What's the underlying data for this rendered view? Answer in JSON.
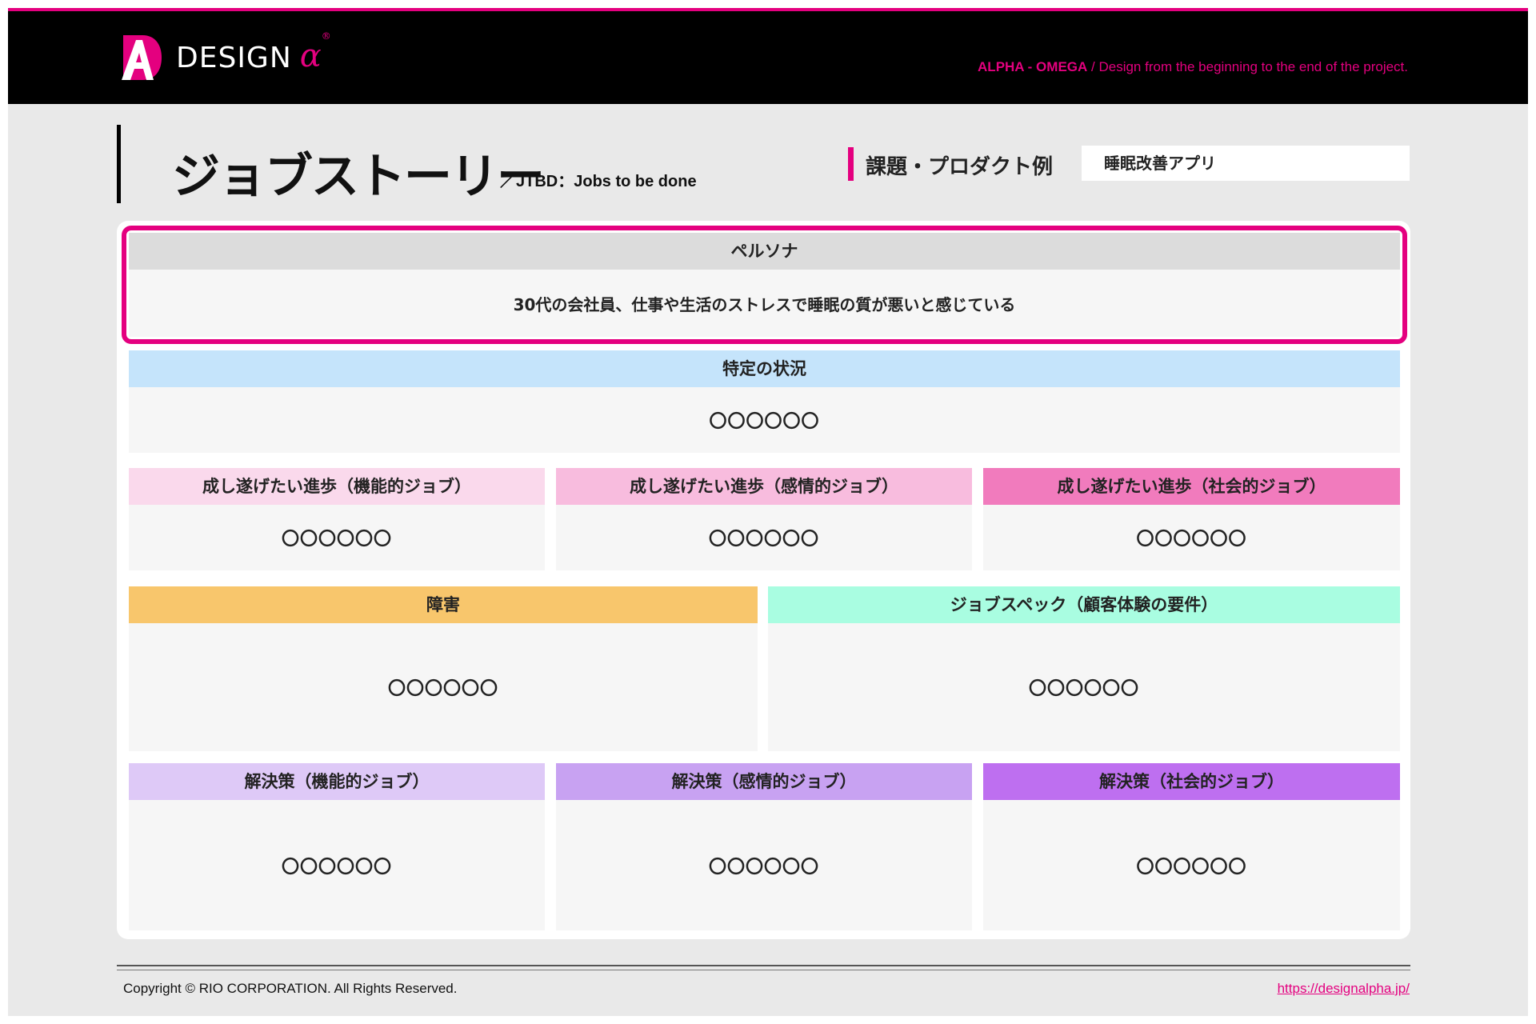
{
  "header": {
    "logo_text": "DESIGN",
    "logo_alpha": "α",
    "logo_reg": "®",
    "tagline_brand": "ALPHA - OMEGA",
    "tagline_rest": " / Design from the beginning to the end of the project."
  },
  "title": {
    "main": "ジョブストーリー",
    "sub": "／JTBD：Jobs to be done",
    "issue_label": "課題・プロダクト例",
    "issue_value": "睡眠改善アプリ"
  },
  "colors": {
    "accent": "#e4007f",
    "persona_header": "#dcdcdc",
    "situation_header": "#c5e4fb",
    "progress_functional": "#fad9ec",
    "progress_emotional": "#f8bcde",
    "progress_social": "#f17bbd",
    "obstacle": "#f8c66c",
    "jobspec": "#a9fde1",
    "solution_functional": "#dec9f7",
    "solution_emotional": "#c8a2f2",
    "solution_social": "#be6ff0"
  },
  "persona": {
    "header": "ペルソナ",
    "body": "30代の会社員、仕事や生活のストレスで睡眠の質が悪いと感じている"
  },
  "situation": {
    "header": "特定の状況",
    "body": "〇〇〇〇〇〇"
  },
  "progress": [
    {
      "header": "成し遂げたい進歩（機能的ジョブ）",
      "body": "〇〇〇〇〇〇"
    },
    {
      "header": "成し遂げたい進歩（感情的ジョブ）",
      "body": "〇〇〇〇〇〇"
    },
    {
      "header": "成し遂げたい進歩（社会的ジョブ）",
      "body": "〇〇〇〇〇〇"
    }
  ],
  "obstacle": {
    "header": "障害",
    "body": "〇〇〇〇〇〇"
  },
  "jobspec": {
    "header": "ジョブスペック（顧客体験の要件）",
    "body": "〇〇〇〇〇〇"
  },
  "solutions": [
    {
      "header": "解決策（機能的ジョブ）",
      "body": "〇〇〇〇〇〇"
    },
    {
      "header": "解決策（感情的ジョブ）",
      "body": "〇〇〇〇〇〇"
    },
    {
      "header": "解決策（社会的ジョブ）",
      "body": "〇〇〇〇〇〇"
    }
  ],
  "footer": {
    "copyright": "Copyright © RIO CORPORATION. All Rights Reserved.",
    "link": "https://designalpha.jp/"
  }
}
